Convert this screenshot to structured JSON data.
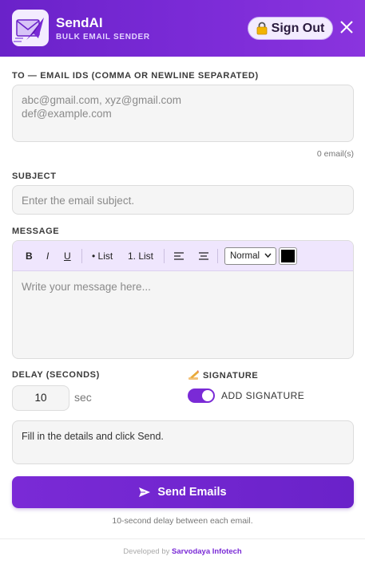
{
  "header": {
    "title": "SendAI",
    "subtitle": "BULK EMAIL SENDER",
    "signout_label": "Sign Out",
    "signout_icon": "lock-icon",
    "close_icon": "close-icon",
    "brand_color": "#7a2ad6"
  },
  "to": {
    "label": "TO — EMAIL IDS (COMMA OR NEWLINE SEPARATED)",
    "placeholder_line1": "abc@gmail.com, xyz@gmail.com",
    "placeholder_line2": "def@example.com",
    "count": "0 email(s)"
  },
  "subject": {
    "label": "SUBJECT",
    "placeholder": "Enter the email subject."
  },
  "message": {
    "label": "MESSAGE",
    "placeholder": "Write your message here...",
    "toolbar": {
      "bold": "B",
      "italic": "I",
      "underline": "U",
      "bullet_list": "• List",
      "numbered_list": "1. List",
      "align_left_icon": "align-left-icon",
      "align_center_icon": "align-center-icon",
      "size_value": "Normal",
      "text_color": "#000000"
    }
  },
  "delay": {
    "label": "DELAY (SECONDS)",
    "value": "10",
    "unit": "sec"
  },
  "signature": {
    "label": "SIGNATURE",
    "icon": "writing-hand-icon",
    "toggle_label": "ADD SIGNATURE",
    "enabled": true
  },
  "status": {
    "text": "Fill in the details and click Send."
  },
  "send": {
    "label": "Send Emails",
    "icon": "send-icon",
    "note": "10-second delay between each email."
  },
  "footer": {
    "prefix": "Developed by",
    "brand": "Sarvodaya Infotech"
  }
}
